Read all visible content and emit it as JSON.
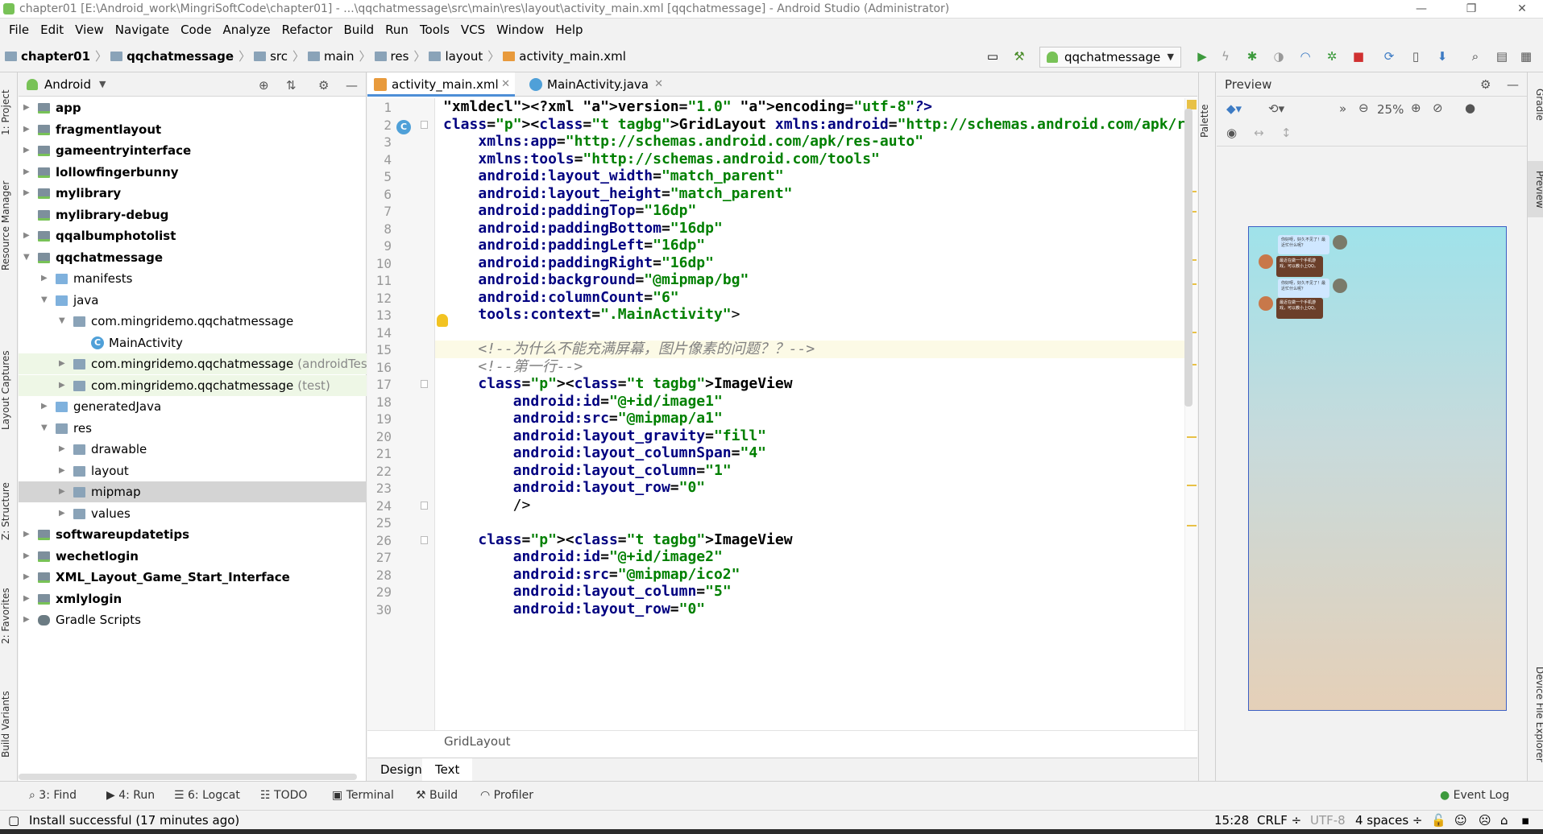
{
  "window": {
    "title": "chapter01 [E:\\Android_work\\MingriSoftCode\\chapter01] - ...\\qqchatmessage\\src\\main\\res\\layout\\activity_main.xml [qqchatmessage] - Android Studio (Administrator)",
    "minimize": "—",
    "maximize": "❐",
    "close": "✕"
  },
  "menu": [
    "File",
    "Edit",
    "View",
    "Navigate",
    "Code",
    "Analyze",
    "Refactor",
    "Build",
    "Run",
    "Tools",
    "VCS",
    "Window",
    "Help"
  ],
  "breadcrumbs": [
    "chapter01",
    "qqchatmessage",
    "src",
    "main",
    "res",
    "layout",
    "activity_main.xml"
  ],
  "run_config": "qqchatmessage",
  "left_tabs": [
    "1: Project",
    "Resource Manager",
    "Layout Captures",
    "Z: Structure",
    "2: Favorites",
    "Build Variants"
  ],
  "project": {
    "view_mode": "Android",
    "tree": [
      {
        "label": "app",
        "bold": true,
        "depth": 0,
        "arrow": "▶",
        "icon": "mod"
      },
      {
        "label": "fragmentlayout",
        "bold": true,
        "depth": 0,
        "arrow": "▶",
        "icon": "mod"
      },
      {
        "label": "gameentryinterface",
        "bold": true,
        "depth": 0,
        "arrow": "▶",
        "icon": "mod"
      },
      {
        "label": "lollowfingerbunny",
        "bold": true,
        "depth": 0,
        "arrow": "▶",
        "icon": "mod"
      },
      {
        "label": "mylibrary",
        "bold": true,
        "depth": 0,
        "arrow": "▶",
        "icon": "mod"
      },
      {
        "label": "mylibrary-debug",
        "bold": true,
        "depth": 0,
        "arrow": "",
        "icon": "mod"
      },
      {
        "label": "qqalbumphotolist",
        "bold": true,
        "depth": 0,
        "arrow": "▶",
        "icon": "mod"
      },
      {
        "label": "qqchatmessage",
        "bold": true,
        "depth": 0,
        "arrow": "▼",
        "icon": "mod"
      },
      {
        "label": "manifests",
        "bold": false,
        "depth": 1,
        "arrow": "▶",
        "icon": "blue"
      },
      {
        "label": "java",
        "bold": false,
        "depth": 1,
        "arrow": "▼",
        "icon": "blue"
      },
      {
        "label": "com.mingridemo.qqchatmessage",
        "bold": false,
        "depth": 2,
        "arrow": "▼",
        "icon": "folder"
      },
      {
        "label": "MainActivity",
        "bold": false,
        "depth": 3,
        "arrow": "",
        "icon": "class"
      },
      {
        "label": "com.mingridemo.qqchatmessage",
        "suffix": "(androidTest)",
        "bold": false,
        "depth": 2,
        "arrow": "▶",
        "icon": "folder",
        "hl": "green"
      },
      {
        "label": "com.mingridemo.qqchatmessage",
        "suffix": "(test)",
        "bold": false,
        "depth": 2,
        "arrow": "▶",
        "icon": "folder",
        "hl": "green"
      },
      {
        "label": "generatedJava",
        "bold": false,
        "depth": 1,
        "arrow": "▶",
        "icon": "blue"
      },
      {
        "label": "res",
        "bold": false,
        "depth": 1,
        "arrow": "▼",
        "icon": "folder"
      },
      {
        "label": "drawable",
        "bold": false,
        "depth": 2,
        "arrow": "▶",
        "icon": "folder"
      },
      {
        "label": "layout",
        "bold": false,
        "depth": 2,
        "arrow": "▶",
        "icon": "folder"
      },
      {
        "label": "mipmap",
        "bold": false,
        "depth": 2,
        "arrow": "▶",
        "icon": "folder",
        "hl": "gray"
      },
      {
        "label": "values",
        "bold": false,
        "depth": 2,
        "arrow": "▶",
        "icon": "folder"
      },
      {
        "label": "softwareupdatetips",
        "bold": true,
        "depth": 0,
        "arrow": "▶",
        "icon": "mod"
      },
      {
        "label": "wechetlogin",
        "bold": true,
        "depth": 0,
        "arrow": "▶",
        "icon": "mod"
      },
      {
        "label": "XML_Layout_Game_Start_Interface",
        "bold": true,
        "depth": 0,
        "arrow": "▶",
        "icon": "mod"
      },
      {
        "label": "xmlylogin",
        "bold": true,
        "depth": 0,
        "arrow": "▶",
        "icon": "mod"
      },
      {
        "label": "Gradle Scripts",
        "bold": false,
        "depth": 0,
        "arrow": "▶",
        "icon": "gradle"
      }
    ]
  },
  "tabs": [
    {
      "label": "activity_main.xml",
      "active": true
    },
    {
      "label": "MainActivity.java",
      "active": false
    }
  ],
  "code_lines": [
    "<?xml version=\"1.0\" encoding=\"utf-8\"?>",
    "<GridLayout xmlns:android=\"http://schemas.android.com/apk/res/android\"",
    "    xmlns:app=\"http://schemas.android.com/apk/res-auto\"",
    "    xmlns:tools=\"http://schemas.android.com/tools\"",
    "    android:layout_width=\"match_parent\"",
    "    android:layout_height=\"match_parent\"",
    "    android:paddingTop=\"16dp\"",
    "    android:paddingBottom=\"16dp\"",
    "    android:paddingLeft=\"16dp\"",
    "    android:paddingRight=\"16dp\"",
    "    android:background=\"@mipmap/bg\"",
    "    android:columnCount=\"6\"",
    "    tools:context=\".MainActivity\">",
    "",
    "    <!--为什么不能充满屏幕，图片像素的问题？？-->",
    "    <!--第一行-->",
    "    <ImageView",
    "        android:id=\"@+id/image1\"",
    "        android:src=\"@mipmap/a1\"",
    "        android:layout_gravity=\"fill\"",
    "        android:layout_columnSpan=\"4\"",
    "        android:layout_column=\"1\"",
    "        android:layout_row=\"0\"",
    "        />",
    "",
    "    <ImageView",
    "        android:id=\"@+id/image2\"",
    "        android:src=\"@mipmap/ico2\"",
    "        android:layout_column=\"5\"",
    "        android:layout_row=\"0\""
  ],
  "editor_breadcrumb": "GridLayout",
  "design_tabs": [
    {
      "label": "Design",
      "active": false
    },
    {
      "label": "Text",
      "active": true
    }
  ],
  "palette_label": "Palette",
  "preview": {
    "title": "Preview",
    "zoom": "25%",
    "bubbles": [
      {
        "text": "你好呀，好久不见了！最近忙什么呢？",
        "side": "right"
      },
      {
        "text": "最近在做一个手机游戏，可以教小上QQ。",
        "side": "left"
      },
      {
        "text": "你好呀，好久不见了！最近忙什么呢？",
        "side": "right"
      },
      {
        "text": "最近在做一个手机游戏，可以教小上QQ。",
        "side": "left"
      }
    ]
  },
  "right_tabs": [
    "Gradle",
    "Preview",
    "Device File Explorer"
  ],
  "bottom_tools": [
    {
      "icon": "search-icon",
      "label": "3: Find"
    },
    {
      "icon": "run-icon",
      "label": "4: Run"
    },
    {
      "icon": "logcat-icon",
      "label": "6: Logcat"
    },
    {
      "icon": "todo-icon",
      "label": "TODO"
    },
    {
      "icon": "terminal-icon",
      "label": "Terminal"
    },
    {
      "icon": "build-icon",
      "label": "Build"
    },
    {
      "icon": "profiler-icon",
      "label": "Profiler"
    }
  ],
  "event_log": "Event Log",
  "status": {
    "message": "Install successful (17 minutes ago)",
    "position": "15:28",
    "line_sep": "CRLF ÷",
    "encoding": "UTF-8",
    "indent": "4 spaces ÷"
  },
  "colors": {
    "accent": "#4d8ed6",
    "android_green": "#78c257",
    "xml_tag": "#000080",
    "xml_string": "#008000"
  }
}
